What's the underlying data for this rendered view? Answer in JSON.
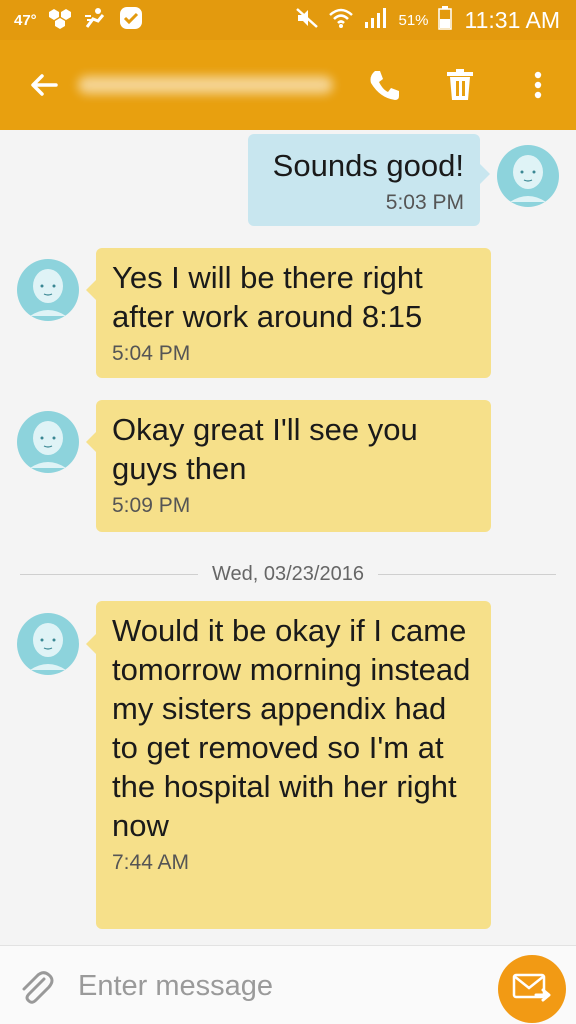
{
  "status_bar": {
    "temperature": "47°",
    "battery_percent": "51%",
    "time": "11:31 AM",
    "icons": [
      "weather-icon",
      "honeycomb-icon",
      "navigation-icon",
      "check-badge-icon",
      "mute-icon",
      "wifi-icon",
      "signal-icon",
      "battery-icon"
    ]
  },
  "app_bar": {
    "contact_name": "",
    "icons": [
      "back-arrow-icon",
      "phone-icon",
      "trash-icon",
      "more-vert-icon"
    ]
  },
  "messages": [
    {
      "direction": "outgoing",
      "text": "Sounds good!",
      "time": "5:03 PM"
    },
    {
      "direction": "incoming",
      "text": "Yes I will be there right after work around 8:15",
      "time": "5:04 PM"
    },
    {
      "direction": "incoming",
      "text": "Okay great I'll see you guys then",
      "time": "5:09 PM"
    },
    {
      "direction": "incoming",
      "text": "Would it be okay if I came tomorrow morning instead my sisters appendix had to get removed so I'm at the hospital with her right now",
      "time": "7:44 AM"
    }
  ],
  "date_divider": "Wed, 03/23/2016",
  "composer": {
    "placeholder": "Enter message",
    "value": "",
    "icons": [
      "paperclip-icon",
      "send-message-icon"
    ]
  },
  "colors": {
    "status_bar": "#e39a0e",
    "app_bar": "#e8a00f",
    "outgoing_bubble": "#c8e6ef",
    "incoming_bubble": "#f6e08a",
    "send_button": "#f29a14",
    "avatar": "#8dd3dc"
  }
}
